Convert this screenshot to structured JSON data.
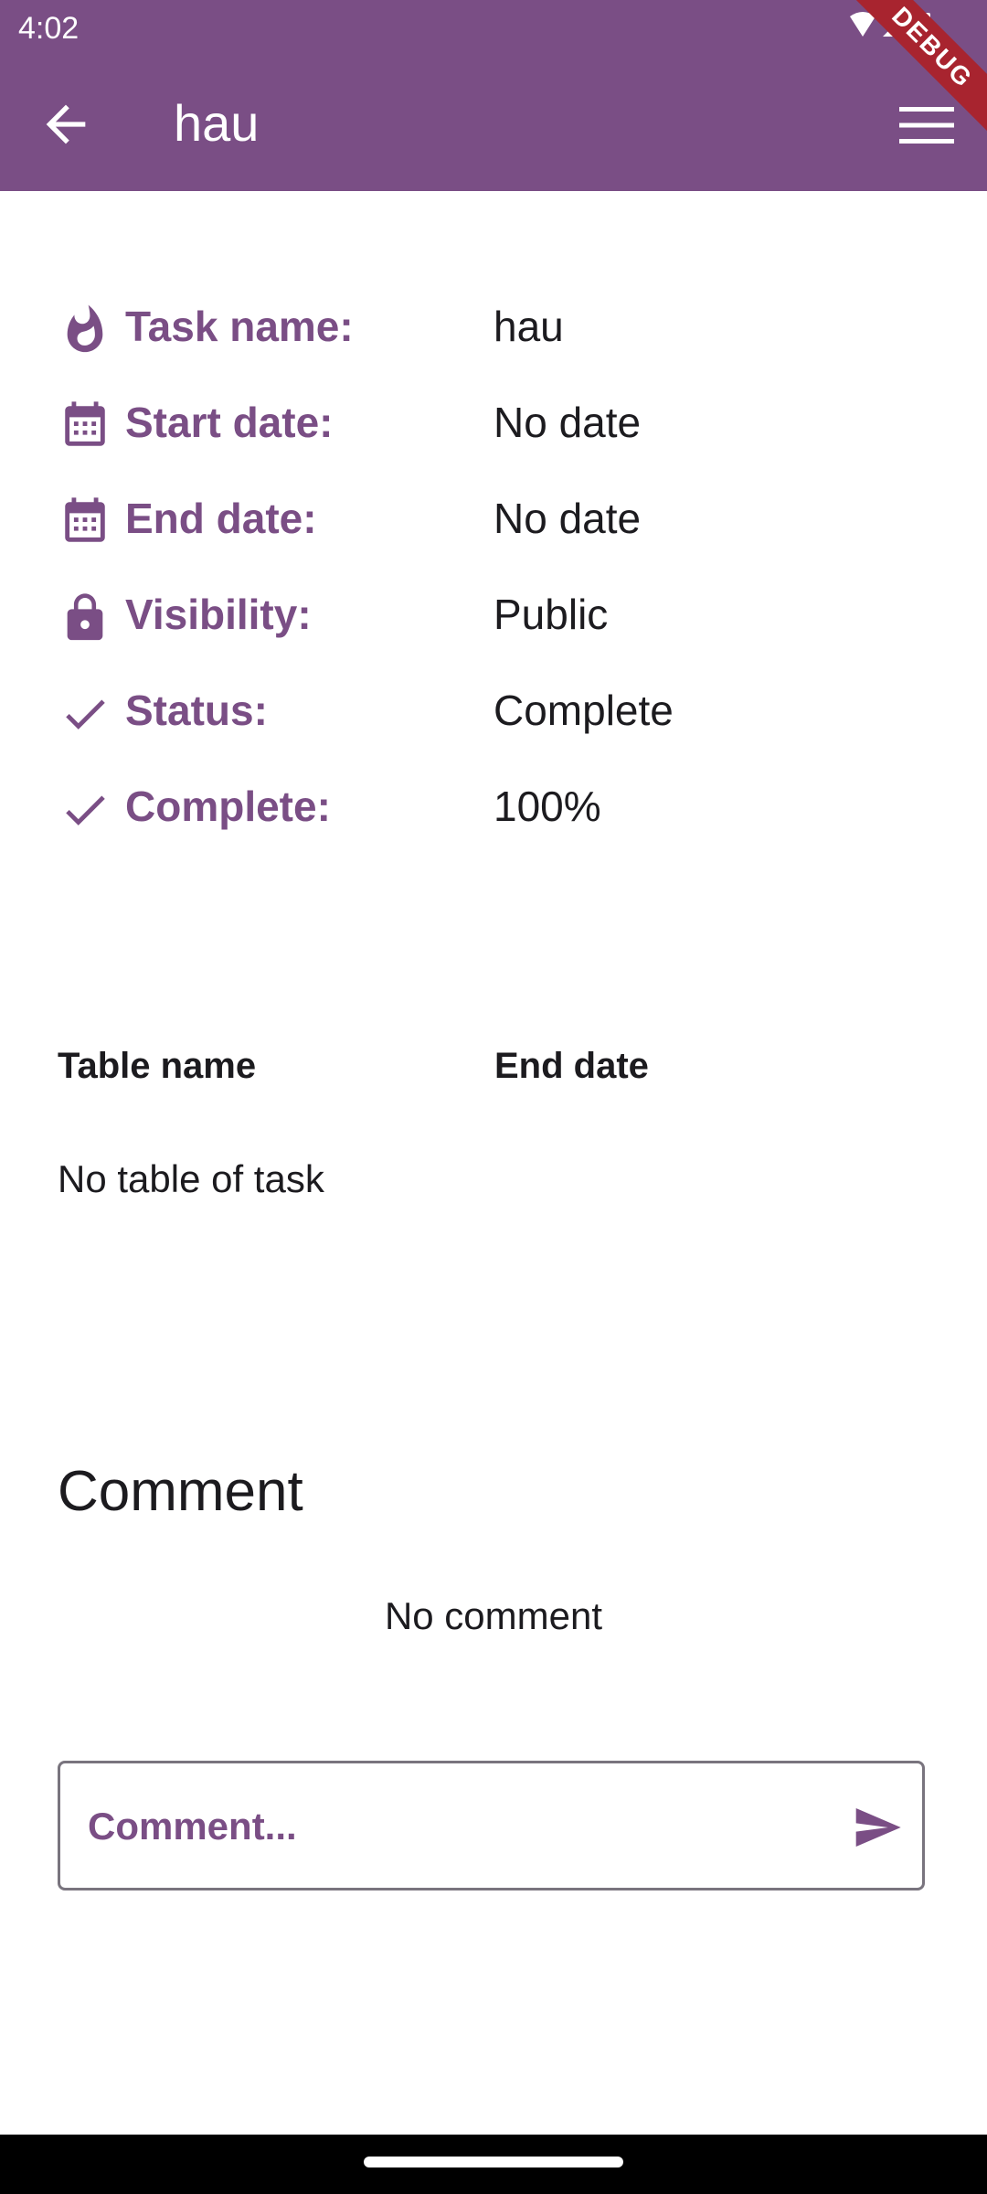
{
  "status_bar": {
    "time": "4:02",
    "icons": [
      "wifi-icon",
      "signal-icon",
      "battery-icon"
    ]
  },
  "app_bar": {
    "title": "hau",
    "back_icon": "arrow-back-icon",
    "menu_icon": "menu-icon"
  },
  "debug_banner": "DEBUG",
  "task_info": [
    {
      "icon": "fire-icon",
      "label": "Task name:",
      "value": "hau"
    },
    {
      "icon": "calendar-icon",
      "label": "Start date:",
      "value": "No date"
    },
    {
      "icon": "calendar-icon",
      "label": "End date:",
      "value": "No date"
    },
    {
      "icon": "lock-icon",
      "label": "Visibility:",
      "value": "Public"
    },
    {
      "icon": "check-icon",
      "label": "Status:",
      "value": "Complete"
    },
    {
      "icon": "check-icon",
      "label": "Complete:",
      "value": "100%"
    }
  ],
  "table": {
    "headers": [
      "Table name",
      "End date"
    ],
    "empty_text": "No table of task"
  },
  "comments": {
    "title": "Comment",
    "empty_text": "No comment",
    "placeholder": "Comment...",
    "send_icon": "send-icon"
  },
  "colors": {
    "primary": "#7a4e85",
    "debug_banner": "#a8242f",
    "text": "#1c1b1f",
    "outline": "#79747e"
  }
}
